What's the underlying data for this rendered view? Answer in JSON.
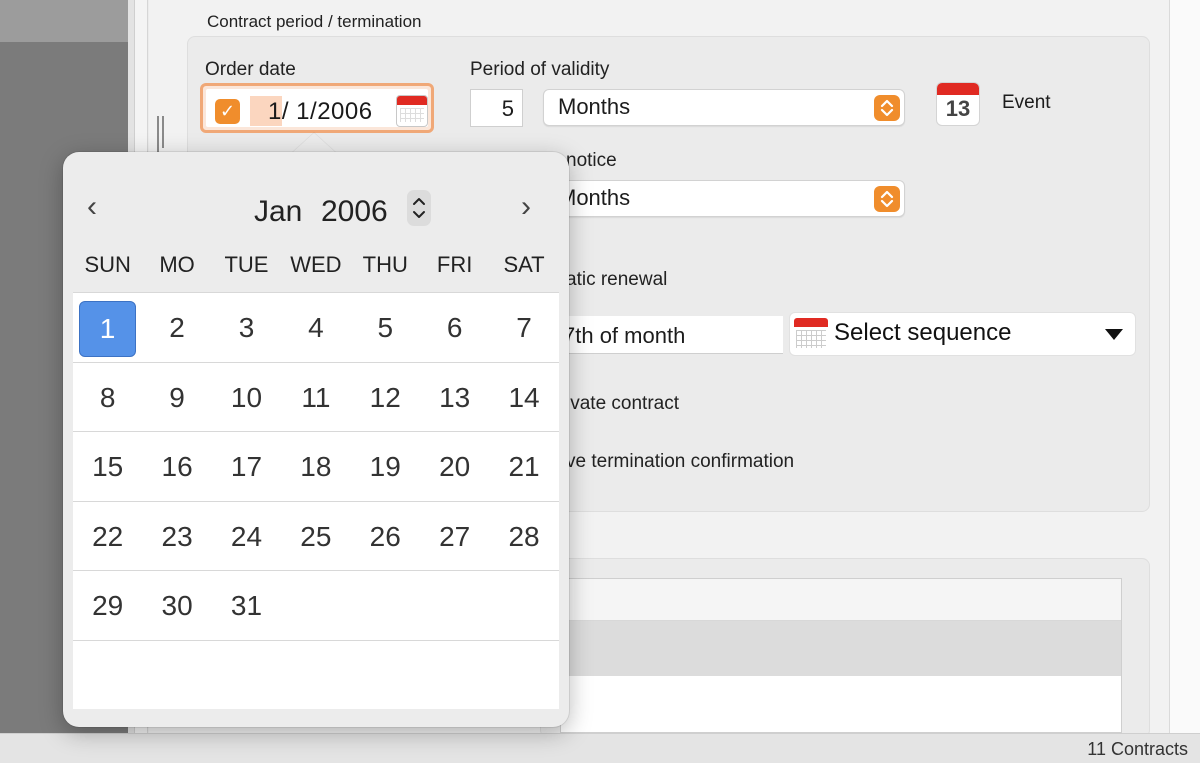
{
  "section": {
    "title": "Contract period / termination"
  },
  "order_date": {
    "label": "Order date",
    "checked": true,
    "value": "1/ 1/2006"
  },
  "validity": {
    "label": "Period of validity",
    "number": "5",
    "unit": "Months"
  },
  "event": {
    "icon_day": "13",
    "label": "Event"
  },
  "notice": {
    "label_visible": "notice",
    "unit": "Months"
  },
  "renewal": {
    "label_visible": "atic renewal",
    "day_field_visible": "7th of month",
    "sequence_label": "Select sequence"
  },
  "private_contract_label_visible": "ivate contract",
  "termination_confirmation_label_visible": "ve termination confirmation",
  "status": {
    "count_label": "11 Contracts"
  },
  "calendar": {
    "month": "Jan",
    "year": "2006",
    "prev_glyph": "‹",
    "next_glyph": "›",
    "weekdays": [
      "SUN",
      "MO",
      "TUE",
      "WED",
      "THU",
      "FRI",
      "SAT"
    ],
    "weeks": [
      [
        "1",
        "2",
        "3",
        "4",
        "5",
        "6",
        "7"
      ],
      [
        "8",
        "9",
        "10",
        "11",
        "12",
        "13",
        "14"
      ],
      [
        "15",
        "16",
        "17",
        "18",
        "19",
        "20",
        "21"
      ],
      [
        "22",
        "23",
        "24",
        "25",
        "26",
        "27",
        "28"
      ],
      [
        "29",
        "30",
        "31",
        "",
        "",
        "",
        ""
      ],
      [
        "",
        "",
        "",
        "",
        "",
        "",
        ""
      ]
    ],
    "selected_day": "1"
  },
  "colors": {
    "accent_orange": "#f08d2c",
    "selection_blue": "#5592e8",
    "calendar_red": "#e02a22"
  }
}
